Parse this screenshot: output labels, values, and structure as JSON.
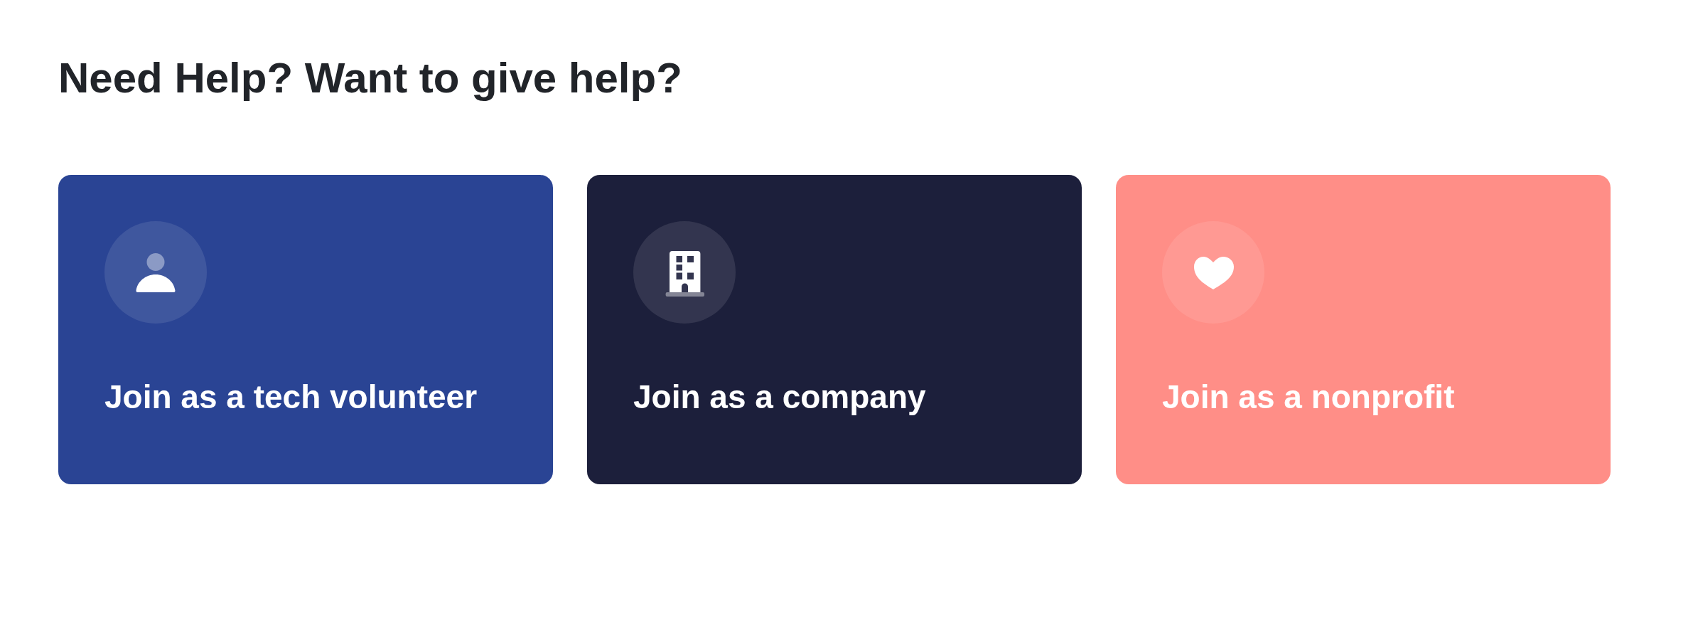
{
  "heading": "Need Help? Want to give help?",
  "cards": [
    {
      "kind": "volunteer",
      "title": "Join as a tech volunteer",
      "color": "#2a4494"
    },
    {
      "kind": "company",
      "title": "Join as a company",
      "color": "#1c1f3b"
    },
    {
      "kind": "nonprofit",
      "title": "Join as a nonprofit",
      "color": "#ff8e87"
    }
  ]
}
